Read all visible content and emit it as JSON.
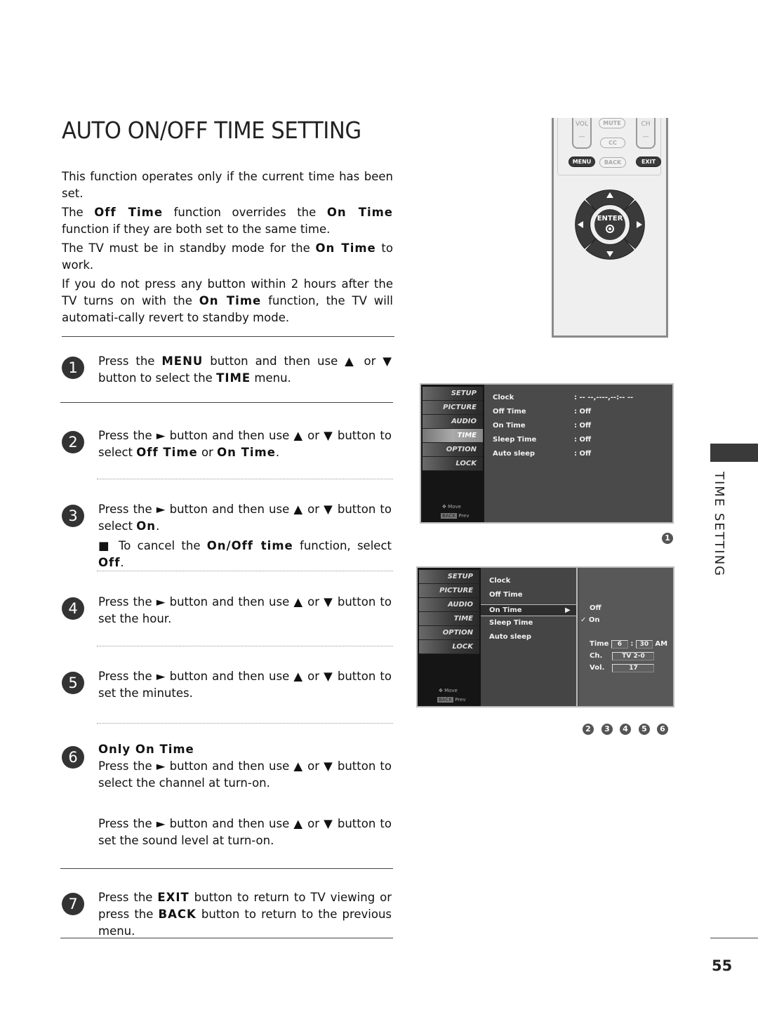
{
  "page": {
    "title": "AUTO ON/OFF TIME SETTING",
    "section_tab": "TIME SETTING",
    "page_number": "55"
  },
  "intro": [
    {
      "parts": [
        "This function operates only if the current time has been set."
      ]
    },
    {
      "parts": [
        "The ",
        "Off Time",
        " function overrides the ",
        "On Time",
        " function if they are both set to the same time."
      ]
    },
    {
      "parts": [
        "The TV must be in standby mode for the ",
        "On Time",
        " to work."
      ]
    },
    {
      "parts": [
        "If you do not press any button within 2 hours after the TV turns on with the ",
        "On Time",
        " function, the TV will automati-cally revert to standby mode."
      ]
    }
  ],
  "steps": [
    {
      "num": "1",
      "parts": [
        "Press the ",
        "MENU",
        " button and then use ▲ or ▼ button to select the ",
        "TIME",
        " menu."
      ]
    },
    {
      "num": "2",
      "parts": [
        "Press the ► button and then use ▲ or ▼ button to select ",
        "Off Time",
        " or ",
        "On Time",
        "."
      ]
    },
    {
      "num": "3",
      "parts": [
        "Press the ► button and then use ▲ or ▼ button to select ",
        "On",
        "."
      ],
      "note_parts": [
        "■ To cancel the ",
        "On/Off time",
        " function, select ",
        "Off",
        "."
      ]
    },
    {
      "num": "4",
      "parts": [
        "Press the ► button and then use ▲ or ▼ button to set the hour."
      ]
    },
    {
      "num": "5",
      "parts": [
        "Press the ► button and then use ▲ or ▼ button to set the minutes."
      ]
    },
    {
      "num": "6",
      "heading": "Only On Time",
      "parts": [
        "Press the ► button and then use ▲ or ▼ button to select the channel at turn-on."
      ],
      "extra": "Press the ► button and then use ▲ or ▼ button to set the sound level at turn-on."
    },
    {
      "num": "7",
      "parts": [
        "Press the ",
        "EXIT",
        " button to return to TV viewing or press the ",
        "BACK",
        " button to return to the previous menu."
      ]
    }
  ],
  "remote": {
    "vol": "VOL",
    "mute": "MUTE",
    "ch": "CH",
    "cc": "CC",
    "menu": "MENU",
    "back": "BACK",
    "exit": "EXIT",
    "enter": "ENTER",
    "minus": "—"
  },
  "osd_sidebar": {
    "items": [
      "SETUP",
      "PICTURE",
      "AUDIO",
      "TIME",
      "OPTION",
      "LOCK"
    ],
    "selected": "TIME",
    "move_hint": "Move",
    "back_key": "BACK",
    "prev_hint": "Prev"
  },
  "osd1": {
    "rows": [
      {
        "label": "Clock",
        "value": ": -- --,----,--:-- --"
      },
      {
        "label": "Off Time",
        "value": ": Off"
      },
      {
        "label": "On Time",
        "value": ": Off"
      },
      {
        "label": "Sleep Time",
        "value": ": Off"
      },
      {
        "label": "Auto sleep",
        "value": ": Off"
      }
    ],
    "callout": "1"
  },
  "osd2": {
    "rows": [
      "Clock",
      "Off Time",
      "On Time",
      "Sleep Time",
      "Auto sleep"
    ],
    "selected": "On Time",
    "options": [
      "Off",
      "On"
    ],
    "checked": "On",
    "check_mark": "✓",
    "time_label": "Time",
    "hour": "6",
    "minute": "30",
    "ampm": "AM",
    "ch_label": "Ch.",
    "ch_value": "TV  2-0",
    "vol_label": "Vol.",
    "vol_value": "17",
    "callouts": [
      "2",
      "3",
      "4",
      "5",
      "6"
    ]
  }
}
